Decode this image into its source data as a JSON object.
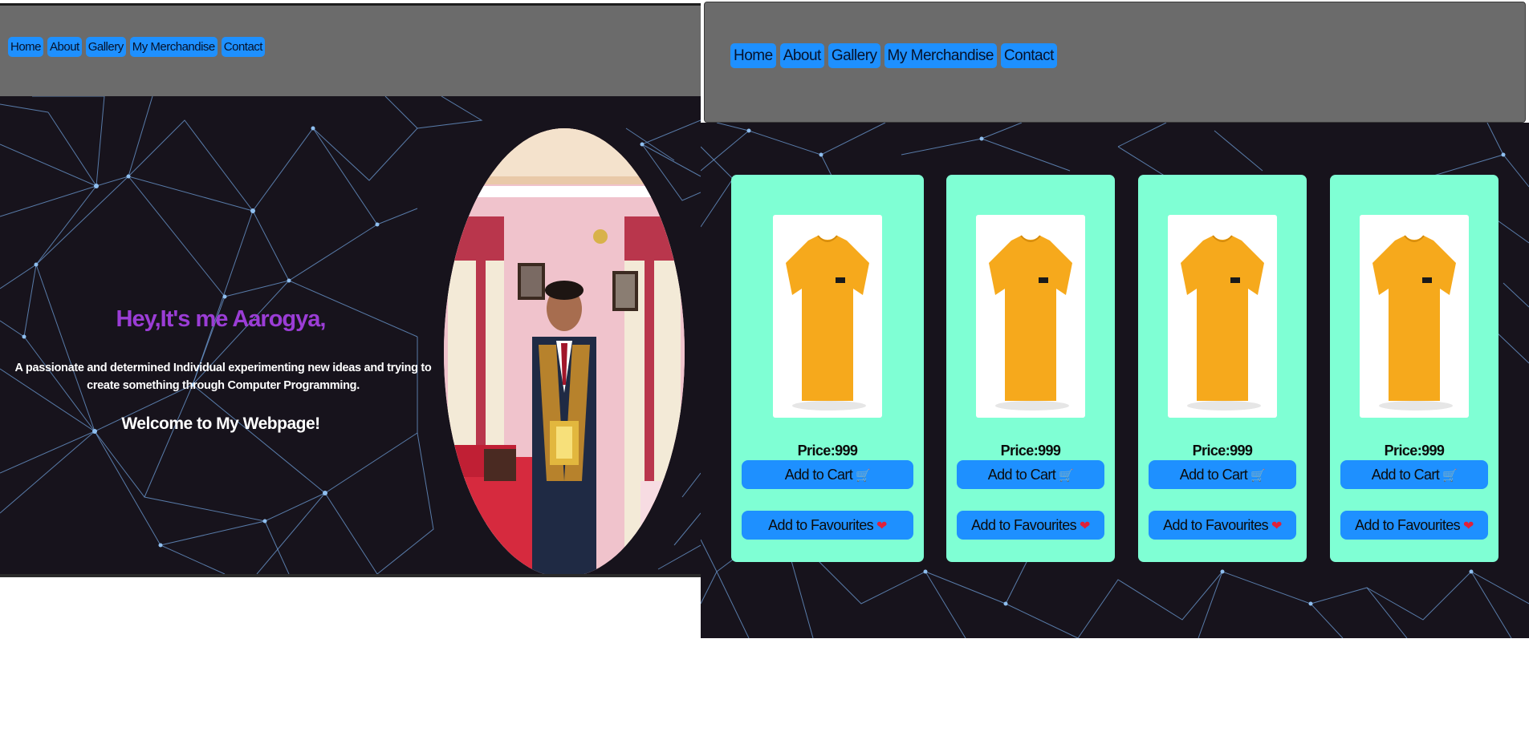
{
  "nav": {
    "items": [
      "Home",
      "About",
      "Gallery",
      "My Merchandise",
      "Contact"
    ]
  },
  "hero": {
    "title": "Hey,It's me Aarogya,",
    "description": "A passionate and determined Individual experimenting new ideas and trying to create something through Computer Programming.",
    "welcome": "Welcome to My Webpage!"
  },
  "products": [
    {
      "price": "Price:999",
      "cart_label": "Add to Cart",
      "cart_icon": "🛒",
      "fav_label": "Add to Favourites",
      "fav_icon": "❤"
    },
    {
      "price": "Price:999",
      "cart_label": "Add to Cart",
      "cart_icon": "🛒",
      "fav_label": "Add to Favourites",
      "fav_icon": "❤"
    },
    {
      "price": "Price:999",
      "cart_label": "Add to Cart",
      "cart_icon": "🛒",
      "fav_label": "Add to Favourites",
      "fav_icon": "❤"
    },
    {
      "price": "Price:999",
      "cart_label": "Add to Cart",
      "cart_icon": "🛒",
      "fav_label": "Add to Favourites",
      "fav_icon": "❤"
    }
  ],
  "colors": {
    "navbar": "#6b6b6b",
    "button": "#1e90ff",
    "card": "#7fffd4",
    "background": "#17131c",
    "title": "#9b3dd6",
    "shirt": "#f6a91c"
  }
}
